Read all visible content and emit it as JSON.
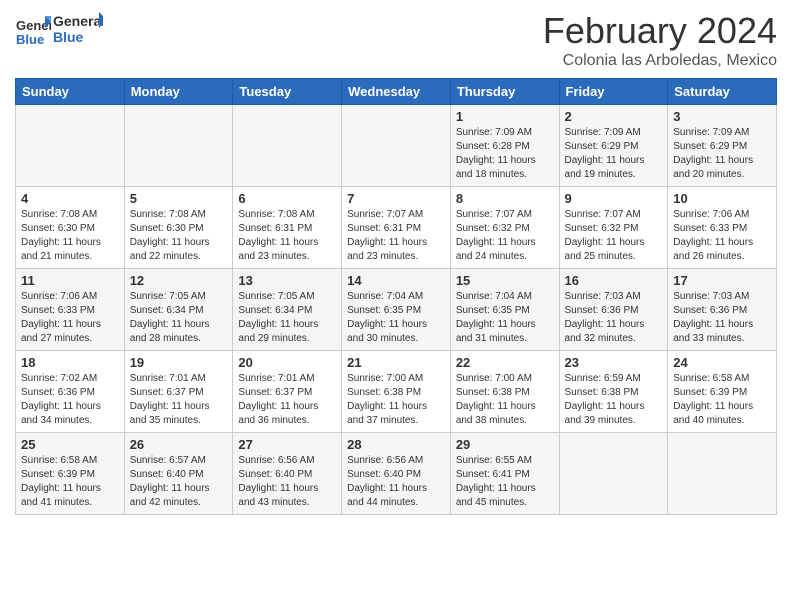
{
  "header": {
    "logo_general": "General",
    "logo_blue": "Blue",
    "main_title": "February 2024",
    "subtitle": "Colonia las Arboledas, Mexico"
  },
  "days_of_week": [
    "Sunday",
    "Monday",
    "Tuesday",
    "Wednesday",
    "Thursday",
    "Friday",
    "Saturday"
  ],
  "weeks": [
    [
      {
        "day": "",
        "info": ""
      },
      {
        "day": "",
        "info": ""
      },
      {
        "day": "",
        "info": ""
      },
      {
        "day": "",
        "info": ""
      },
      {
        "day": "1",
        "info": "Sunrise: 7:09 AM\nSunset: 6:28 PM\nDaylight: 11 hours\nand 18 minutes."
      },
      {
        "day": "2",
        "info": "Sunrise: 7:09 AM\nSunset: 6:29 PM\nDaylight: 11 hours\nand 19 minutes."
      },
      {
        "day": "3",
        "info": "Sunrise: 7:09 AM\nSunset: 6:29 PM\nDaylight: 11 hours\nand 20 minutes."
      }
    ],
    [
      {
        "day": "4",
        "info": "Sunrise: 7:08 AM\nSunset: 6:30 PM\nDaylight: 11 hours\nand 21 minutes."
      },
      {
        "day": "5",
        "info": "Sunrise: 7:08 AM\nSunset: 6:30 PM\nDaylight: 11 hours\nand 22 minutes."
      },
      {
        "day": "6",
        "info": "Sunrise: 7:08 AM\nSunset: 6:31 PM\nDaylight: 11 hours\nand 23 minutes."
      },
      {
        "day": "7",
        "info": "Sunrise: 7:07 AM\nSunset: 6:31 PM\nDaylight: 11 hours\nand 23 minutes."
      },
      {
        "day": "8",
        "info": "Sunrise: 7:07 AM\nSunset: 6:32 PM\nDaylight: 11 hours\nand 24 minutes."
      },
      {
        "day": "9",
        "info": "Sunrise: 7:07 AM\nSunset: 6:32 PM\nDaylight: 11 hours\nand 25 minutes."
      },
      {
        "day": "10",
        "info": "Sunrise: 7:06 AM\nSunset: 6:33 PM\nDaylight: 11 hours\nand 26 minutes."
      }
    ],
    [
      {
        "day": "11",
        "info": "Sunrise: 7:06 AM\nSunset: 6:33 PM\nDaylight: 11 hours\nand 27 minutes."
      },
      {
        "day": "12",
        "info": "Sunrise: 7:05 AM\nSunset: 6:34 PM\nDaylight: 11 hours\nand 28 minutes."
      },
      {
        "day": "13",
        "info": "Sunrise: 7:05 AM\nSunset: 6:34 PM\nDaylight: 11 hours\nand 29 minutes."
      },
      {
        "day": "14",
        "info": "Sunrise: 7:04 AM\nSunset: 6:35 PM\nDaylight: 11 hours\nand 30 minutes."
      },
      {
        "day": "15",
        "info": "Sunrise: 7:04 AM\nSunset: 6:35 PM\nDaylight: 11 hours\nand 31 minutes."
      },
      {
        "day": "16",
        "info": "Sunrise: 7:03 AM\nSunset: 6:36 PM\nDaylight: 11 hours\nand 32 minutes."
      },
      {
        "day": "17",
        "info": "Sunrise: 7:03 AM\nSunset: 6:36 PM\nDaylight: 11 hours\nand 33 minutes."
      }
    ],
    [
      {
        "day": "18",
        "info": "Sunrise: 7:02 AM\nSunset: 6:36 PM\nDaylight: 11 hours\nand 34 minutes."
      },
      {
        "day": "19",
        "info": "Sunrise: 7:01 AM\nSunset: 6:37 PM\nDaylight: 11 hours\nand 35 minutes."
      },
      {
        "day": "20",
        "info": "Sunrise: 7:01 AM\nSunset: 6:37 PM\nDaylight: 11 hours\nand 36 minutes."
      },
      {
        "day": "21",
        "info": "Sunrise: 7:00 AM\nSunset: 6:38 PM\nDaylight: 11 hours\nand 37 minutes."
      },
      {
        "day": "22",
        "info": "Sunrise: 7:00 AM\nSunset: 6:38 PM\nDaylight: 11 hours\nand 38 minutes."
      },
      {
        "day": "23",
        "info": "Sunrise: 6:59 AM\nSunset: 6:38 PM\nDaylight: 11 hours\nand 39 minutes."
      },
      {
        "day": "24",
        "info": "Sunrise: 6:58 AM\nSunset: 6:39 PM\nDaylight: 11 hours\nand 40 minutes."
      }
    ],
    [
      {
        "day": "25",
        "info": "Sunrise: 6:58 AM\nSunset: 6:39 PM\nDaylight: 11 hours\nand 41 minutes."
      },
      {
        "day": "26",
        "info": "Sunrise: 6:57 AM\nSunset: 6:40 PM\nDaylight: 11 hours\nand 42 minutes."
      },
      {
        "day": "27",
        "info": "Sunrise: 6:56 AM\nSunset: 6:40 PM\nDaylight: 11 hours\nand 43 minutes."
      },
      {
        "day": "28",
        "info": "Sunrise: 6:56 AM\nSunset: 6:40 PM\nDaylight: 11 hours\nand 44 minutes."
      },
      {
        "day": "29",
        "info": "Sunrise: 6:55 AM\nSunset: 6:41 PM\nDaylight: 11 hours\nand 45 minutes."
      },
      {
        "day": "",
        "info": ""
      },
      {
        "day": "",
        "info": ""
      }
    ]
  ]
}
